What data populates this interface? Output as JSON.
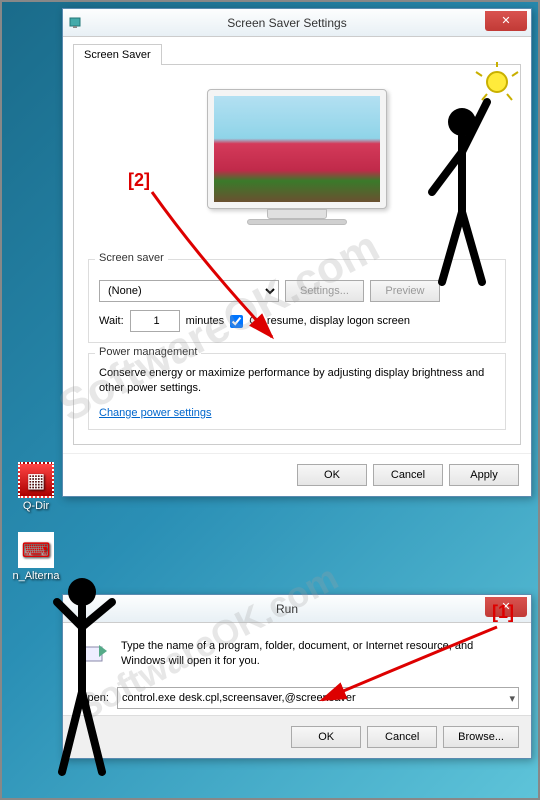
{
  "desktop": {
    "icons": [
      {
        "name": "qdir",
        "label": "Q-Dir"
      },
      {
        "name": "alterna",
        "label": "n_Alterna"
      }
    ]
  },
  "screensaver_window": {
    "title": "Screen Saver Settings",
    "tab_label": "Screen Saver",
    "group1_title": "Screen saver",
    "saver_dropdown": "(None)",
    "settings_btn": "Settings...",
    "preview_btn": "Preview",
    "wait_label": "Wait:",
    "wait_value": "1",
    "minutes_label": "minutes",
    "onresume_checked": true,
    "onresume_label": "On resume, display logon screen",
    "group2_title": "Power management",
    "power_text": "Conserve energy or maximize performance by adjusting display brightness and other power settings.",
    "power_link": "Change power settings",
    "ok": "OK",
    "cancel": "Cancel",
    "apply": "Apply"
  },
  "run_window": {
    "title": "Run",
    "description": "Type the name of a program, folder, document, or Internet resource, and Windows will open it for you.",
    "open_label": "Open:",
    "open_value": "control.exe desk.cpl,screensaver,@screensaver",
    "ok": "OK",
    "cancel": "Cancel",
    "browse": "Browse..."
  },
  "annotations": {
    "label1": "[1]",
    "label2": "[2]"
  },
  "watermark": "SoftwareOK.com"
}
